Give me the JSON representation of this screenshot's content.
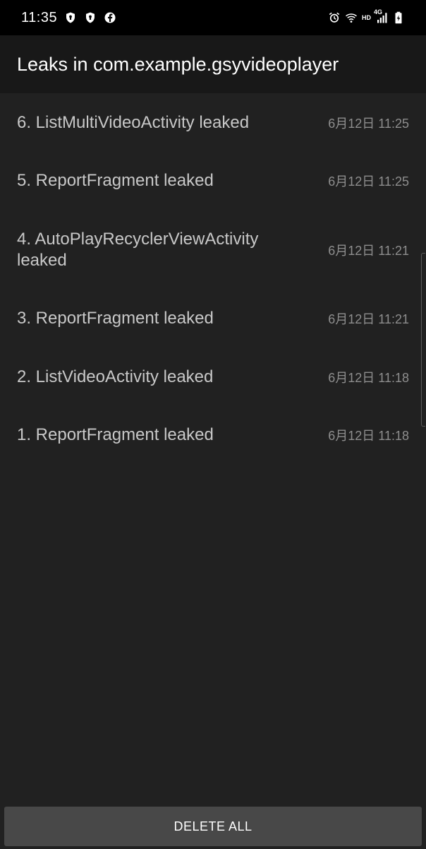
{
  "status_bar": {
    "time": "11:35",
    "left_icons": [
      "shield-icon",
      "shield-icon",
      "facebook-icon"
    ],
    "right_icons": [
      "alarm-icon",
      "wifi-icon",
      "hd-label",
      "4g-signal-icon",
      "battery-charging-icon"
    ],
    "hd_text": "HD",
    "network_text": "4G"
  },
  "app_bar": {
    "title": "Leaks in com.example.gsyvideoplayer"
  },
  "leaks": [
    {
      "title": "6. ListMultiVideoActivity leaked",
      "time": "6月12日 11:25"
    },
    {
      "title": "5. ReportFragment leaked",
      "time": "6月12日 11:25"
    },
    {
      "title": "4. AutoPlayRecyclerViewActivity leaked",
      "time": "6月12日 11:21"
    },
    {
      "title": "3. ReportFragment leaked",
      "time": "6月12日 11:21"
    },
    {
      "title": "2. ListVideoActivity leaked",
      "time": "6月12日 11:18"
    },
    {
      "title": "1. ReportFragment leaked",
      "time": "6月12日 11:18"
    }
  ],
  "actions": {
    "delete_all_label": "DELETE ALL"
  }
}
